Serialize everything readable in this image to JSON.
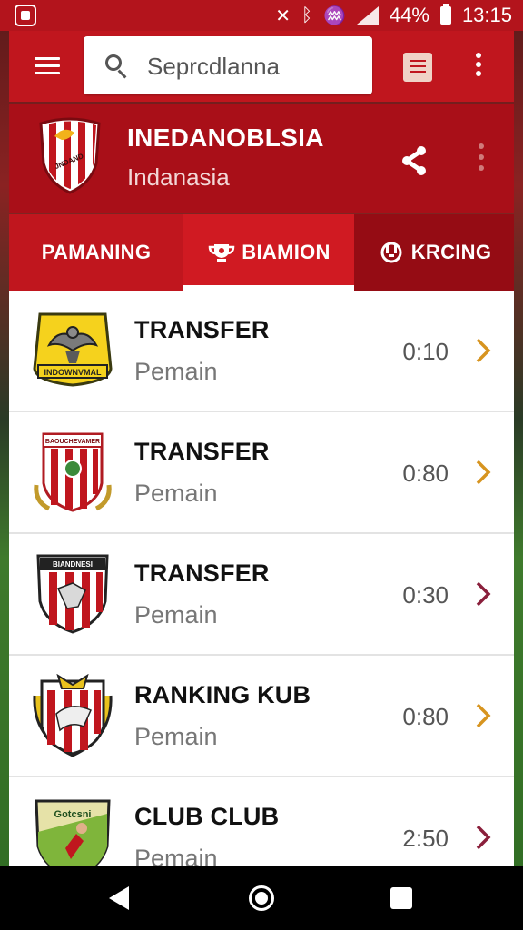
{
  "status_bar": {
    "battery": "44%",
    "time": "13:15"
  },
  "app_bar": {
    "search_placeholder": "Seprcdlanna",
    "icons": [
      "menu-icon",
      "search-icon",
      "note-icon",
      "more-vert-icon"
    ]
  },
  "club": {
    "name": "INEDANOBLSIA",
    "subtitle": "Indanasia",
    "logo_text": "JNDAND"
  },
  "tabs": [
    {
      "label": "PAMANING"
    },
    {
      "label": "BIAMION",
      "icon": "trophy-icon",
      "selected": true
    },
    {
      "label": "KRCING",
      "icon": "ranking-icon"
    }
  ],
  "list": [
    {
      "title": "TRANSFER",
      "subtitle": "Pemain",
      "time": "0:10",
      "logo_text": "INDOWNVMAL",
      "chevron_color": "#d7941f"
    },
    {
      "title": "TRANSFER",
      "subtitle": "Pemain",
      "time": "0:80",
      "logo_text": "BAOUCHEVAMER",
      "chevron_color": "#d7941f"
    },
    {
      "title": "TRANSFER",
      "subtitle": "Pemain",
      "time": "0:30",
      "logo_text": "BIANDNESI",
      "chevron_color": "#8a1f3b"
    },
    {
      "title": "RANKING  KUB",
      "subtitle": "Pemain",
      "time": "0:80",
      "logo_text": "",
      "chevron_color": "#d7941f"
    },
    {
      "title": "CLUB CLUB",
      "subtitle": "Pemain",
      "time": "2:50",
      "logo_text": "Gotcsni",
      "chevron_color": "#8a1f3b"
    }
  ],
  "colors": {
    "primary": "#c0161e",
    "header": "#a90f18",
    "tab_dark": "#950c14",
    "accent_gold": "#d7941f",
    "accent_maroon": "#8a1f3b"
  }
}
